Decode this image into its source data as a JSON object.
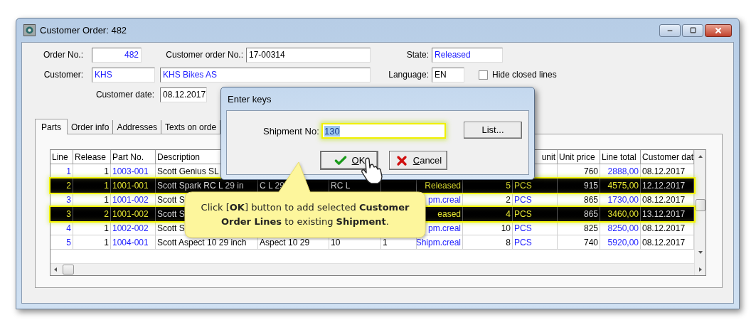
{
  "window": {
    "title": "Customer Order: 482"
  },
  "form": {
    "order_no": {
      "label": "Order No.:",
      "value": "482"
    },
    "customer_order_no": {
      "label": "Customer order No.:",
      "value": "17-00314"
    },
    "state": {
      "label": "State:",
      "value": "Released"
    },
    "customer": {
      "label": "Customer:",
      "code": "KHS",
      "name": "KHS Bikes AS"
    },
    "language": {
      "label": "Language:",
      "value": "EN"
    },
    "hide_closed": {
      "label": "Hide closed lines",
      "checked": false
    },
    "customer_date": {
      "label": "Customer date:",
      "value": "08.12.2017"
    }
  },
  "tabs": [
    {
      "label": "Parts",
      "selected": true
    },
    {
      "label": "Order info",
      "selected": false
    },
    {
      "label": "Addresses",
      "selected": false
    },
    {
      "label": "Texts on orde",
      "selected": false
    }
  ],
  "table": {
    "columns": [
      {
        "label": "Line"
      },
      {
        "label": "Release"
      },
      {
        "label": "Part No."
      },
      {
        "label": "Description"
      },
      {},
      {},
      {},
      {},
      {},
      {
        "label": "unit"
      },
      {
        "label": "Unit price"
      },
      {
        "label": "Line total"
      },
      {
        "label": "Customer dat"
      }
    ],
    "rows": [
      {
        "selected": false,
        "cells": [
          "1",
          "1",
          "1003-001",
          "Scott Genius SL",
          null,
          null,
          null,
          null,
          null,
          null,
          "760",
          "2888,00",
          "08.12.2017"
        ]
      },
      {
        "selected": true,
        "cells": [
          "2",
          "1",
          "1001-001",
          "Scott Spark RC L 29 in",
          "C L 29",
          "RC L",
          null,
          "Released",
          "5",
          "PCS",
          "915",
          "4575,00",
          "12.12.2017"
        ]
      },
      {
        "selected": false,
        "cells": [
          "3",
          "1",
          "1001-002",
          "Scott S",
          null,
          null,
          null,
          "pm.creal",
          "2",
          "PCS",
          "865",
          "1730,00",
          "08.12.2017"
        ]
      },
      {
        "selected": true,
        "cells": [
          "3",
          "2",
          "1001-002",
          "Scott S",
          null,
          null,
          null,
          "eased",
          "4",
          "PCS",
          "865",
          "3460,00",
          "13.12.2017"
        ]
      },
      {
        "selected": false,
        "cells": [
          "4",
          "1",
          "1002-002",
          "Scott S",
          null,
          null,
          null,
          "pm.creal",
          "10",
          "PCS",
          "825",
          "8250,00",
          "08.12.2017"
        ]
      },
      {
        "selected": false,
        "cells": [
          "5",
          "1",
          "1004-001",
          "Scott Aspect 10 29 inch",
          "Aspect 10 29",
          "10",
          "1",
          "Shipm.creal",
          "8",
          "PCS",
          "740",
          "5920,00",
          "08.12.2017"
        ]
      }
    ]
  },
  "dialog": {
    "title": "Enter keys",
    "field": {
      "label": "Shipment No:",
      "value": "130"
    },
    "buttons": [
      {
        "kind": "list",
        "label": "List..."
      },
      {
        "kind": "ok",
        "label": "OK"
      },
      {
        "kind": "cancel",
        "label": "Cancel"
      }
    ]
  },
  "callout": {
    "text": "Click [**OK**] button to add selected **Customer Order Lines** to existing **Shipment**."
  }
}
